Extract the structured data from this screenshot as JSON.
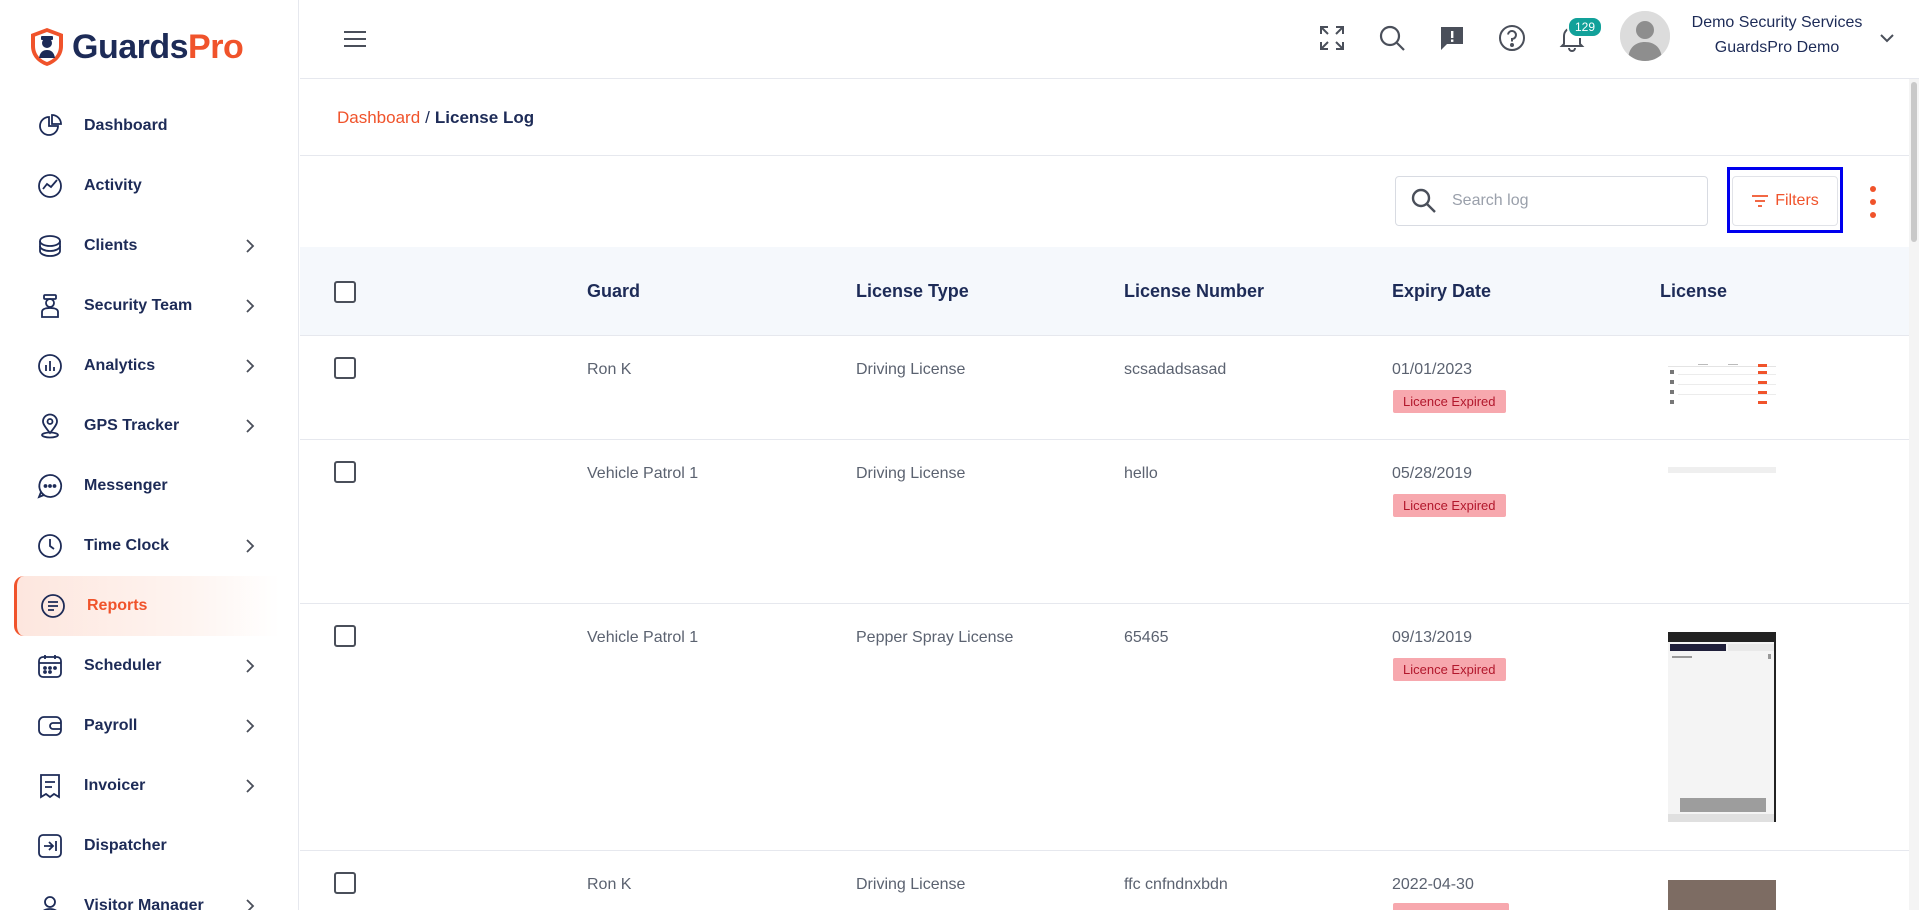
{
  "brand": {
    "name_a": "Guards",
    "name_b": "Pro",
    "accent": "#f0532b",
    "navy": "#1d2b57"
  },
  "sidebar": {
    "items": [
      {
        "label": "Dashboard",
        "icon": "pie-chart-icon",
        "chevron": false,
        "active": false
      },
      {
        "label": "Activity",
        "icon": "activity-chart-icon",
        "chevron": false,
        "active": false
      },
      {
        "label": "Clients",
        "icon": "briefcase-icon",
        "chevron": true,
        "active": false
      },
      {
        "label": "Security Team",
        "icon": "guard-user-icon",
        "chevron": true,
        "active": false
      },
      {
        "label": "Analytics",
        "icon": "bar-chart-icon",
        "chevron": true,
        "active": false
      },
      {
        "label": "GPS Tracker",
        "icon": "map-pin-icon",
        "chevron": true,
        "active": false
      },
      {
        "label": "Messenger",
        "icon": "chat-bubble-icon",
        "chevron": false,
        "active": false
      },
      {
        "label": "Time Clock",
        "icon": "clock-icon",
        "chevron": true,
        "active": false
      },
      {
        "label": "Reports",
        "icon": "document-list-icon",
        "chevron": false,
        "active": true
      },
      {
        "label": "Scheduler",
        "icon": "calendar-icon",
        "chevron": true,
        "active": false
      },
      {
        "label": "Payroll",
        "icon": "wallet-icon",
        "chevron": true,
        "active": false
      },
      {
        "label": "Invoicer",
        "icon": "invoice-icon",
        "chevron": true,
        "active": false
      },
      {
        "label": "Dispatcher",
        "icon": "dispatch-arrow-icon",
        "chevron": false,
        "active": false
      },
      {
        "label": "Visitor Manager",
        "icon": "visitor-icon",
        "chevron": true,
        "active": false
      }
    ]
  },
  "header": {
    "notification_count": "129",
    "user": {
      "company": "Demo Security Services",
      "account": "GuardsPro Demo"
    }
  },
  "breadcrumb": {
    "root": "Dashboard",
    "separator": "/",
    "current": "License Log"
  },
  "toolbar": {
    "search_placeholder": "Search log",
    "filters_label": "Filters"
  },
  "table": {
    "columns": [
      "Guard",
      "License Type",
      "License Number",
      "Expiry Date",
      "License"
    ],
    "rows": [
      {
        "guard": "Ron K",
        "license_type": "Driving License",
        "license_number": "scsadadsasad",
        "expiry": "01/01/2023",
        "status": "Licence Expired"
      },
      {
        "guard": "Vehicle Patrol 1",
        "license_type": "Driving License",
        "license_number": "hello",
        "expiry": "05/28/2019",
        "status": "Licence Expired"
      },
      {
        "guard": "Vehicle Patrol 1",
        "license_type": "Pepper Spray License",
        "license_number": "65465",
        "expiry": "09/13/2019",
        "status": "Licence Expired"
      },
      {
        "guard": "Ron K",
        "license_type": "Driving License",
        "license_number": "ffc cnfndnxbdn",
        "expiry": "2022-04-30",
        "status": ""
      }
    ]
  }
}
